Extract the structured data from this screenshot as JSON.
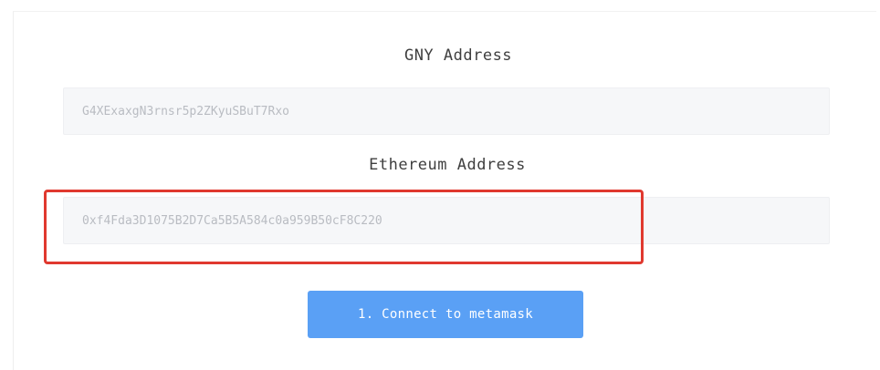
{
  "form": {
    "gny_label": "GNY Address",
    "gny_value": "G4XExaxgN3rnsr5p2ZKyuSBuT7Rxo",
    "eth_label": "Ethereum Address",
    "eth_value": "0xf4Fda3D1075B2D7Ca5B5A584c0a959B50cF8C220",
    "connect_button": "1. Connect to metamask"
  },
  "colors": {
    "button": "#5aa0f5",
    "highlight": "#e0392f",
    "field_bg": "#f6f7f9"
  }
}
